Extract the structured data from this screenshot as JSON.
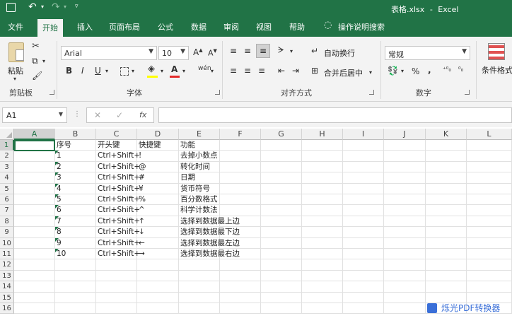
{
  "title_bar": {
    "document_title": "表格.xlsx",
    "app_name": "Excel",
    "separator": "-"
  },
  "tabs": [
    {
      "label": "文件",
      "active": false
    },
    {
      "label": "开始",
      "active": true
    },
    {
      "label": "插入",
      "active": false
    },
    {
      "label": "页面布局",
      "active": false
    },
    {
      "label": "公式",
      "active": false
    },
    {
      "label": "数据",
      "active": false
    },
    {
      "label": "审阅",
      "active": false
    },
    {
      "label": "视图",
      "active": false
    },
    {
      "label": "帮助",
      "active": false
    }
  ],
  "tell_me": "操作说明搜索",
  "ribbon": {
    "clipboard": {
      "paste": "粘贴",
      "group": "剪贴板"
    },
    "font": {
      "name": "Arial",
      "size": "10",
      "bold": "B",
      "italic": "I",
      "underline": "U",
      "grow": "A",
      "shrink": "A",
      "font_color": "A",
      "phonetic": "wén",
      "group": "字体"
    },
    "alignment": {
      "wrap": "自动换行",
      "merge": "合并后居中",
      "group": "对齐方式"
    },
    "number": {
      "format": "常规",
      "percent": "%",
      "comma": ",",
      "group": "数字"
    },
    "styles": {
      "conditional": "条件格式"
    }
  },
  "formula_bar": {
    "name_box": "A1",
    "fx": "fx",
    "cancel": "✕",
    "enter": "✓",
    "formula": ""
  },
  "columns": [
    "A",
    "B",
    "C",
    "D",
    "E",
    "F",
    "G",
    "H",
    "I",
    "J",
    "K",
    "L"
  ],
  "rows": [
    "1",
    "2",
    "3",
    "4",
    "5",
    "6",
    "7",
    "8",
    "9",
    "10",
    "11",
    "12",
    "13",
    "14",
    "15",
    "16"
  ],
  "sheet": {
    "headers": {
      "b": "序号",
      "c": "开头键",
      "d": "快捷键",
      "e": "功能"
    },
    "data": [
      {
        "no": "1",
        "key": "Ctrl+Shift+",
        "shortcut": "!",
        "func": "去掉小数点"
      },
      {
        "no": "2",
        "key": "Ctrl+Shift+",
        "shortcut": "@",
        "func": "转化时间"
      },
      {
        "no": "3",
        "key": "Ctrl+Shift+",
        "shortcut": "#",
        "func": "日期"
      },
      {
        "no": "4",
        "key": "Ctrl+Shift+",
        "shortcut": "¥",
        "func": "货币符号"
      },
      {
        "no": "5",
        "key": "Ctrl+Shift+",
        "shortcut": "%",
        "func": "百分数格式"
      },
      {
        "no": "6",
        "key": "Ctrl+Shift+",
        "shortcut": "^",
        "func": "科学计数法"
      },
      {
        "no": "7",
        "key": "Ctrl+Shift+",
        "shortcut": "↑",
        "func": "选择到数据最上边"
      },
      {
        "no": "8",
        "key": "Ctrl+Shift+",
        "shortcut": "↓",
        "func": "选择到数据最下边"
      },
      {
        "no": "9",
        "key": "Ctrl+Shift+",
        "shortcut": "←",
        "func": "选择到数据最左边"
      },
      {
        "no": "10",
        "key": "Ctrl+Shift+",
        "shortcut": "→",
        "func": "选择到数据最右边"
      }
    ]
  },
  "watermark": "烁光PDF转换器",
  "colors": {
    "excel_green": "#217346",
    "indicator": "#1e7145"
  }
}
